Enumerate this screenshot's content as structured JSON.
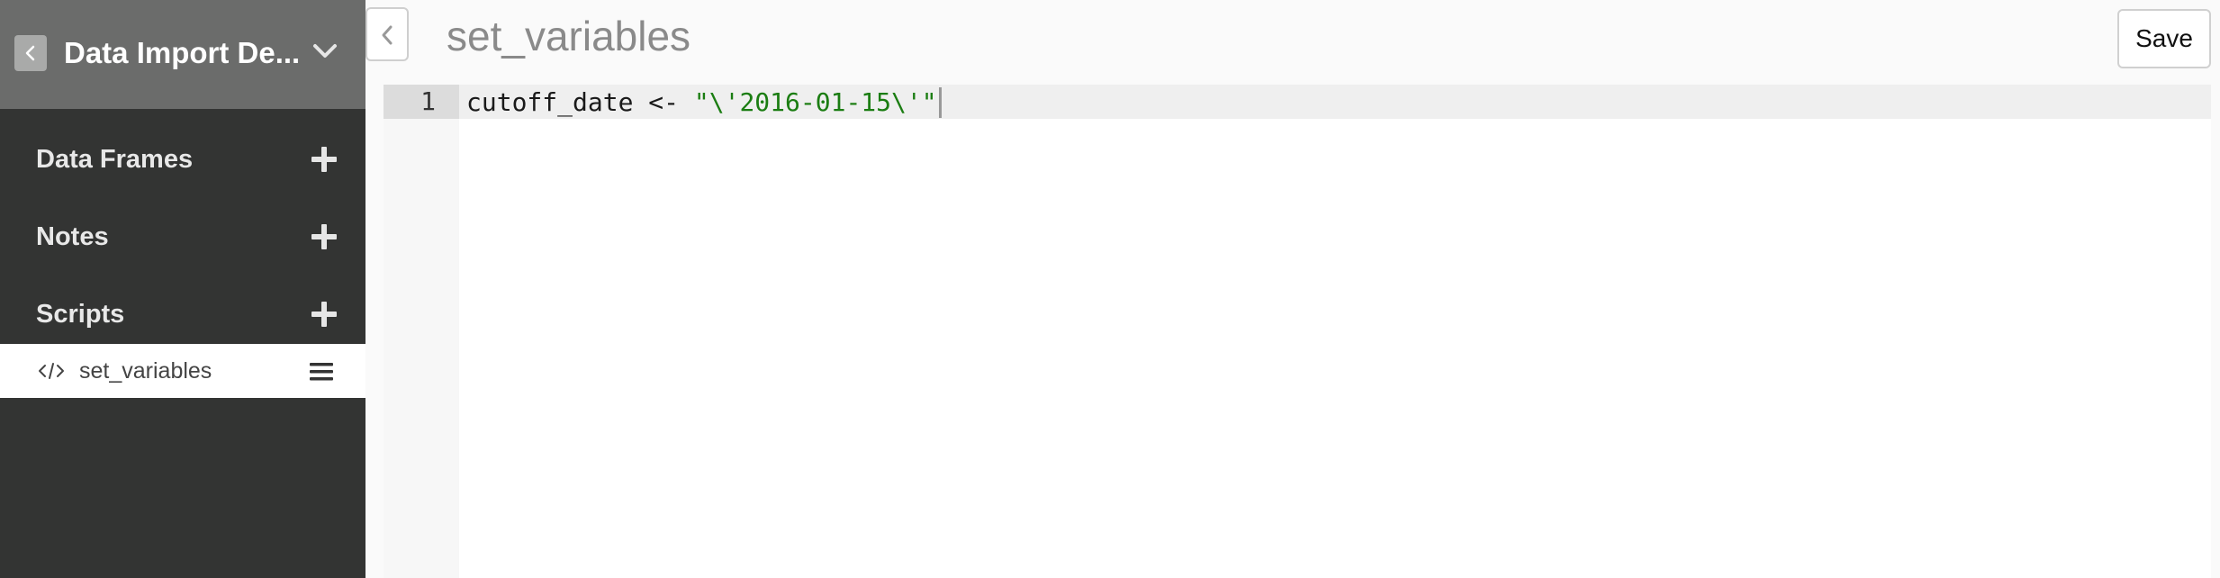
{
  "sidebar": {
    "workspace_title": "Data Import De...",
    "sections": [
      {
        "label": "Data Frames"
      },
      {
        "label": "Notes"
      },
      {
        "label": "Scripts"
      }
    ],
    "scripts": [
      {
        "label": "set_variables"
      }
    ]
  },
  "main": {
    "title": "set_variables",
    "save_label": "Save"
  },
  "editor": {
    "line_number": "1",
    "code_prefix": "cutoff_date <- ",
    "code_string": "\"\\'2016-01-15\\'\""
  },
  "colors": {
    "sidebar_bg": "#333433",
    "sidebar_header_bg": "#6b6c6b",
    "string_color": "#1b7d12"
  }
}
